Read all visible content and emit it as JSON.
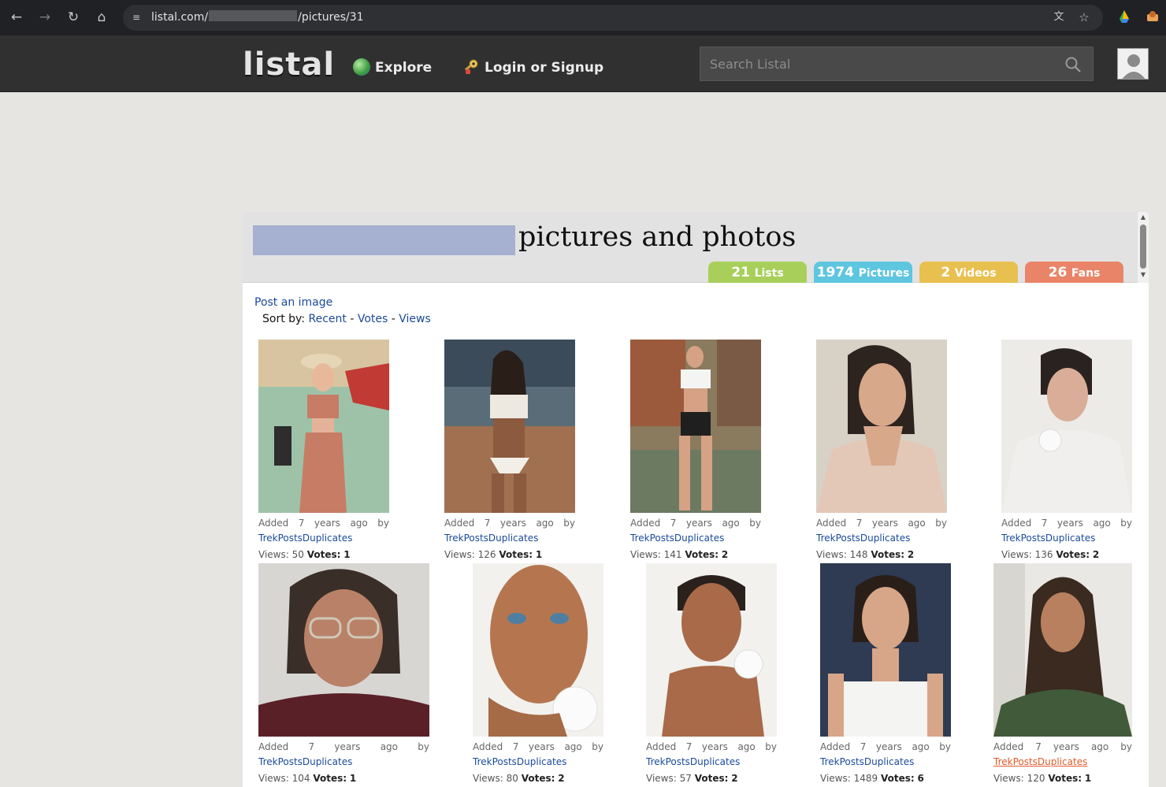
{
  "browser": {
    "url_prefix": "listal.com/",
    "url_suffix": "/pictures/31"
  },
  "header": {
    "logo": "listal",
    "explore": "Explore",
    "login": "Login or Signup",
    "search_placeholder": "Search Listal"
  },
  "page": {
    "title": "pictures and photos",
    "post_image": "Post an image",
    "sort_label": "Sort by:",
    "sort_recent": "Recent",
    "sort_votes": "Votes",
    "sort_views": "Views",
    "sort_sep": "-"
  },
  "tabs": {
    "lists": {
      "count": "21",
      "label": "Lists",
      "color": "#a8cf5a"
    },
    "pictures": {
      "count": "1974",
      "label": "Pictures",
      "color": "#5ec6de"
    },
    "videos": {
      "count": "2",
      "label": "Videos",
      "color": "#e8c050"
    },
    "fans": {
      "count": "26",
      "label": "Fans",
      "color": "#ea8468"
    }
  },
  "text": {
    "added": "Added",
    "num": "7",
    "years": "years",
    "ago": "ago",
    "by": "by",
    "views": "Views:",
    "votes": "Votes:"
  },
  "pictures": [
    {
      "user": "TrekPostsDuplicates",
      "views": "50",
      "votes": "1"
    },
    {
      "user": "TrekPostsDuplicates",
      "views": "126",
      "votes": "1"
    },
    {
      "user": "TrekPostsDuplicates",
      "views": "141",
      "votes": "2"
    },
    {
      "user": "TrekPostsDuplicates",
      "views": "148",
      "votes": "2"
    },
    {
      "user": "TrekPostsDuplicates",
      "views": "136",
      "votes": "2"
    },
    {
      "user": "TrekPostsDuplicates",
      "views": "104",
      "votes": "1"
    },
    {
      "user": "TrekPostsDuplicates",
      "views": "80",
      "votes": "2"
    },
    {
      "user": "TrekPostsDuplicates",
      "views": "57",
      "votes": "2"
    },
    {
      "user": "TrekPostsDuplicates",
      "views": "1489",
      "votes": "6"
    },
    {
      "user": "TrekPostsDuplicates",
      "views": "120",
      "votes": "1"
    }
  ]
}
